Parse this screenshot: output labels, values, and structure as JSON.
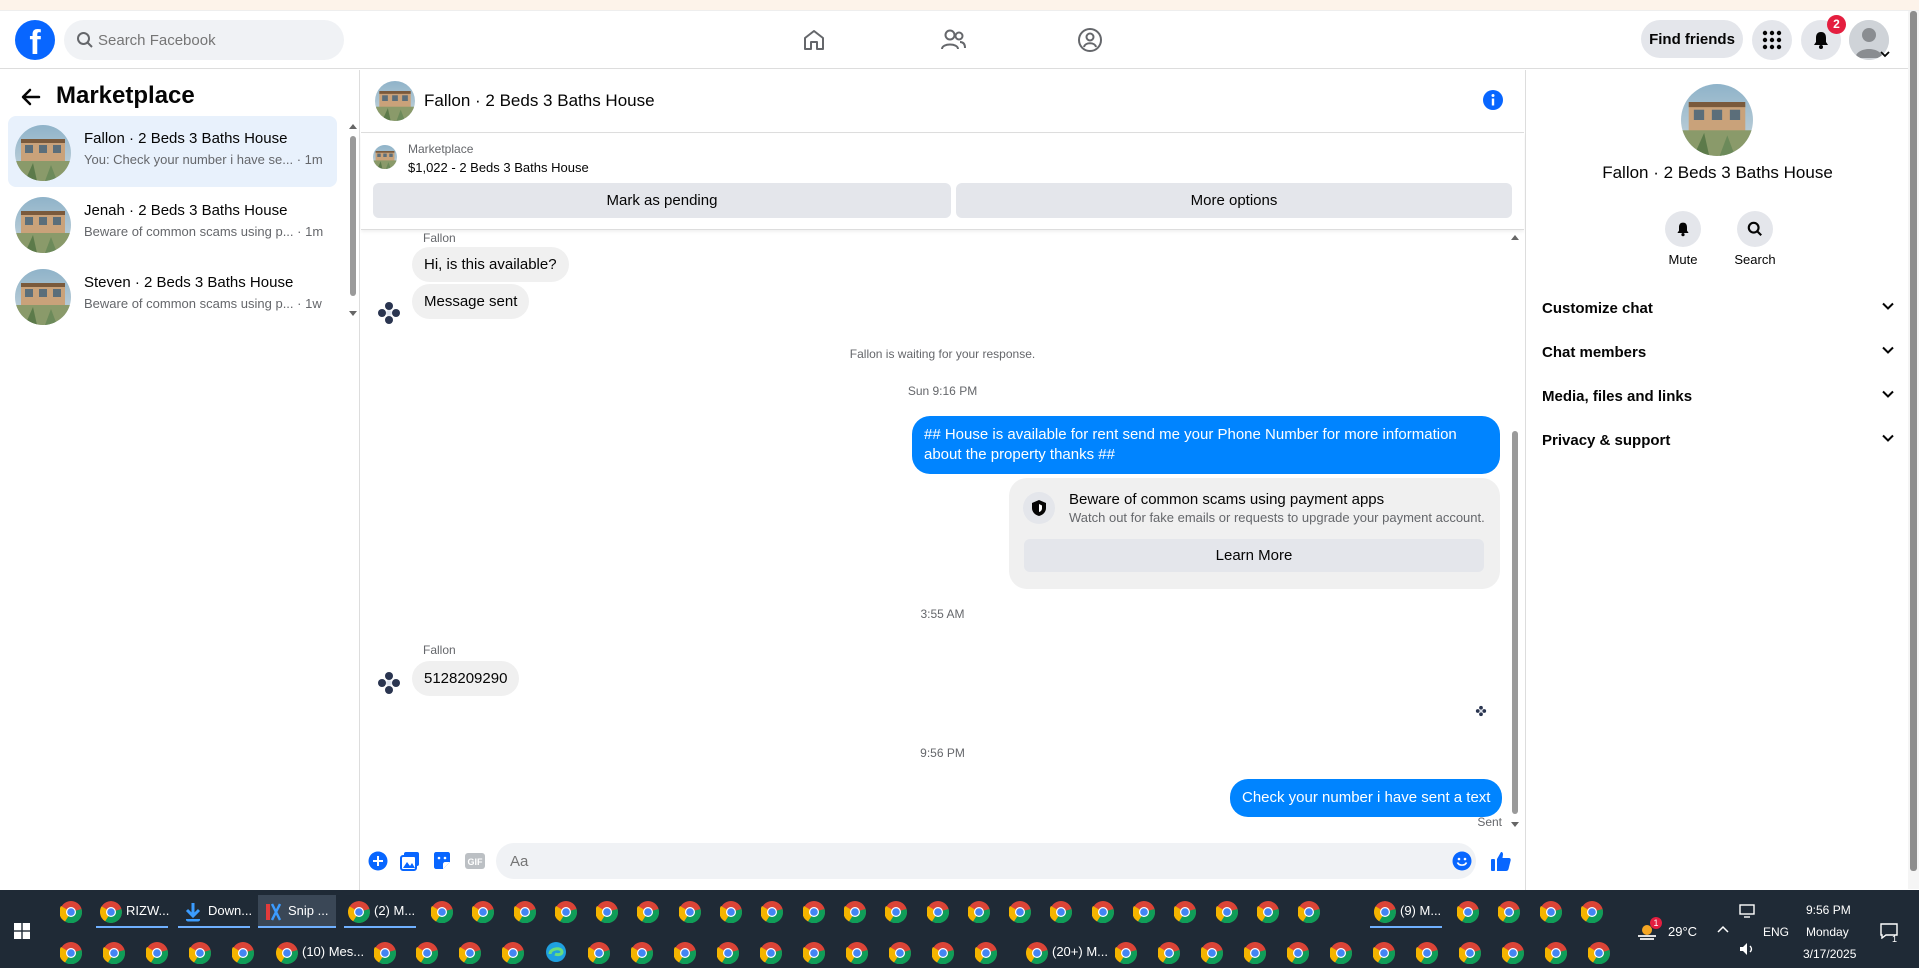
{
  "browser_strip": "",
  "topbar": {
    "search_placeholder": "Search Facebook",
    "find_friends": "Find friends",
    "notification_count": "2"
  },
  "left": {
    "title": "Marketplace",
    "conversations": [
      {
        "name": "Fallon · 2 Beds 3 Baths House",
        "preview": "You: Check your number i have se... · 1m"
      },
      {
        "name": "Jenah · 2 Beds 3 Baths House",
        "preview": "Beware of common scams using p... · 1m"
      },
      {
        "name": "Steven · 2 Beds 3 Baths House",
        "preview": "Beware of common scams using p... · 1w"
      }
    ]
  },
  "chat": {
    "title": "Fallon · 2 Beds 3 Baths House",
    "listing_category": "Marketplace",
    "listing_price": "$1,022 - 2 Beds 3 Baths House",
    "mark_pending": "Mark as pending",
    "more_options": "More options",
    "sender1": "Fallon",
    "msg1": "Hi, is this available?",
    "msg2": "Message sent",
    "waiting": "Fallon is waiting for your response.",
    "time1": "Sun 9:16 PM",
    "out1": "## House is available for rent send me your Phone Number for more information about the property thanks ##",
    "scam_title": "Beware of common scams using payment apps",
    "scam_desc": "Watch out for fake emails or requests to upgrade your payment account.",
    "learn_more": "Learn More",
    "time2": "3:55 AM",
    "sender2": "Fallon",
    "msg3": "5128209290",
    "time3": "9:56 PM",
    "out2": "Check your number i have sent a text",
    "sent": "Sent",
    "composer_placeholder": "Aa",
    "gif_label": "GIF"
  },
  "right": {
    "title": "Fallon · 2 Beds 3 Baths House",
    "mute": "Mute",
    "search": "Search",
    "sections": [
      "Customize chat",
      "Chat members",
      "Media, files and links",
      "Privacy & support"
    ]
  },
  "taskbar": {
    "items": [
      "RIZW...",
      "Down...",
      "Snip ...",
      "(2) M...",
      "(9) M...",
      "(10) Mes...",
      "(20+) M..."
    ],
    "weather_temp": "29°C",
    "weather_badge": "1",
    "lang": "ENG",
    "time": "9:56 PM",
    "day": "Monday",
    "date": "3/17/2025",
    "notif_count": "1"
  },
  "colors": {
    "brand": "#0866ff",
    "messenger_blue": "#0084ff",
    "badge_red": "#e41e3f"
  }
}
